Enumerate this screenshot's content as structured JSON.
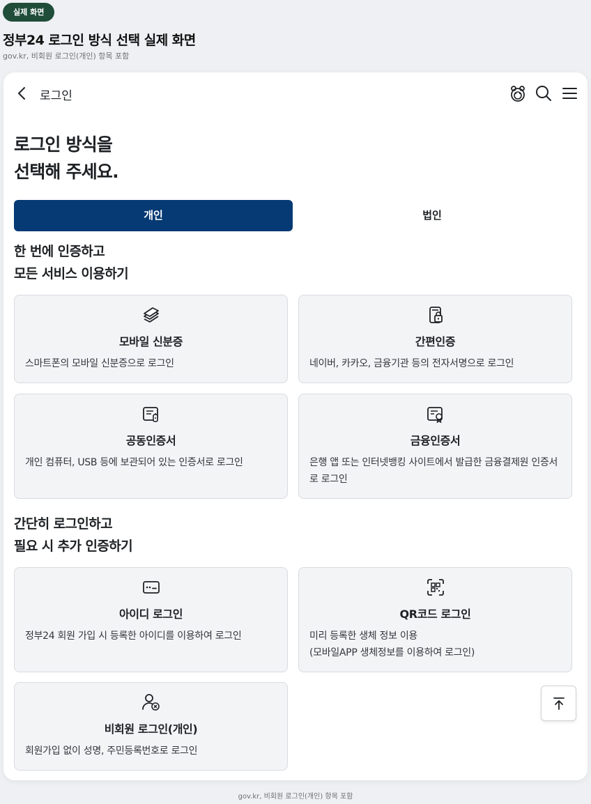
{
  "badge": "실제 화면",
  "doc": {
    "title": "정부24 로그인 방식 선택 실제 화면",
    "subtitle": "gov.kr, 비회원 로그인(개인) 항목 포함"
  },
  "topbar": {
    "title": "로그인",
    "icons": [
      "back-icon",
      "mascot-icon",
      "search-icon",
      "menu-icon"
    ]
  },
  "heading": {
    "line1": "로그인 방식을",
    "line2": "선택해 주세요."
  },
  "tabs": [
    {
      "label": "개인",
      "active": true
    },
    {
      "label": "법인",
      "active": false
    }
  ],
  "sections": [
    {
      "line1": "한 번에 인증하고",
      "line2": "모든 서비스 이용하기",
      "cards": [
        {
          "icon": "mobile-id-icon",
          "title": "모바일 신분증",
          "desc": "스마트폰의 모바일 신분증으로 로그인"
        },
        {
          "icon": "simple-auth-icon",
          "title": "간편인증",
          "desc": "네이버, 카카오, 금융기관 등의 전자서명으로 로그인"
        },
        {
          "icon": "joint-cert-icon",
          "title": "공동인증서",
          "desc": "개인 컴퓨터, USB 등에 보관되어 있는 인증서로 로그인"
        },
        {
          "icon": "financial-cert-icon",
          "title": "금융인증서",
          "desc": "은행 앱 또는 인터넷뱅킹 사이트에서 발급한 금융결제원 인증서로 로그인"
        }
      ]
    },
    {
      "line1": "간단히 로그인하고",
      "line2": "필요 시 추가 인증하기",
      "cards": [
        {
          "icon": "id-login-icon",
          "title": "아이디 로그인",
          "desc": "정부24 회원 가입 시 등록한 아이디를 이용하여 로그인"
        },
        {
          "icon": "qr-code-icon",
          "title": "QR코드 로그인",
          "desc_line1": "미리 등록한 생체 정보 이용",
          "desc_line2": "(모바일APP 생체정보를 이용하여 로그인)"
        },
        {
          "icon": "non-member-icon",
          "title": "비회원 로그인(개인)",
          "desc": "회원가입 없이 성명, 주민등록번호로 로그인"
        }
      ]
    }
  ],
  "footer": "gov.kr, 비회원 로그인(개인) 항목 포함",
  "colors": {
    "primary": "#063a74",
    "badge": "#1f4d3a",
    "card_bg": "#f3f4f6",
    "page_bg": "#eef0f3"
  }
}
